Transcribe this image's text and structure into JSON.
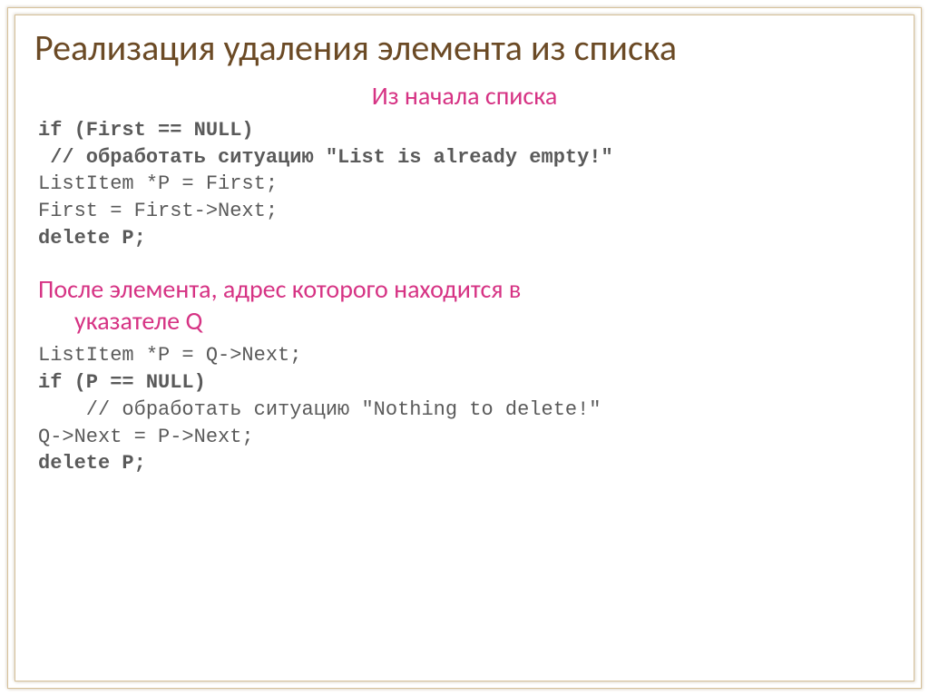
{
  "title": "Реализация удаления элемента из списка",
  "section1": {
    "heading": "Из начала списка",
    "code_l1": "if (First == NULL)",
    "code_l2": " // обработать ситуацию ″List is already empty!″",
    "code_l3": "ListItem *P = First;",
    "code_l4": "First = First->Next;",
    "code_l5": "delete P;"
  },
  "section2": {
    "heading_line1": "После элемента, адрес которого находится в",
    "heading_line2": "указателе Q",
    "code_l1": "ListItem *P = Q->Next;",
    "code_l2": "if (P == NULL)",
    "code_l3": "    // обработать ситуацию ″Nothing to delete!″",
    "code_l4": "Q->Next = P->Next;",
    "code_l5": "delete P;"
  }
}
